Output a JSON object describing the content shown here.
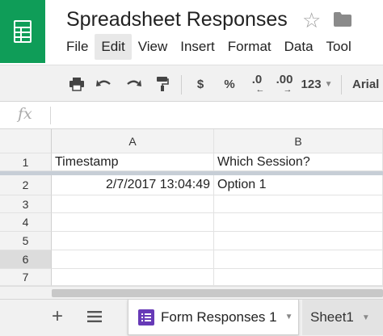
{
  "header": {
    "title": "Spreadsheet Responses",
    "menu": [
      "File",
      "Edit",
      "View",
      "Insert",
      "Format",
      "Data",
      "Tool"
    ],
    "active_menu_index": 1
  },
  "toolbar": {
    "icons": [
      "print-icon",
      "undo-icon",
      "redo-icon",
      "paint-format-icon"
    ],
    "currency": "$",
    "percent": "%",
    "decrease_decimal": ".0",
    "increase_decimal": ".00",
    "more_formats": "123",
    "font": "Arial"
  },
  "formula_bar": {
    "fx_label": "fx",
    "value": ""
  },
  "grid": {
    "columns": [
      "A",
      "B"
    ],
    "rows": [
      {
        "num": "1",
        "a": "Timestamp",
        "b": "Which Session?"
      },
      {
        "num": "2",
        "a": "2/7/2017 13:04:49",
        "b": "Option 1"
      },
      {
        "num": "3",
        "a": "",
        "b": ""
      },
      {
        "num": "4",
        "a": "",
        "b": ""
      },
      {
        "num": "5",
        "a": "",
        "b": ""
      },
      {
        "num": "6",
        "a": "",
        "b": ""
      },
      {
        "num": "7",
        "a": "",
        "b": ""
      }
    ],
    "selected_row": "6"
  },
  "sheets": {
    "tabs": [
      {
        "label": "Form Responses 1",
        "active": true
      },
      {
        "label": "Sheet1",
        "active": false
      }
    ]
  },
  "colors": {
    "brand": "#0f9d58",
    "form_icon": "#673ab7"
  }
}
